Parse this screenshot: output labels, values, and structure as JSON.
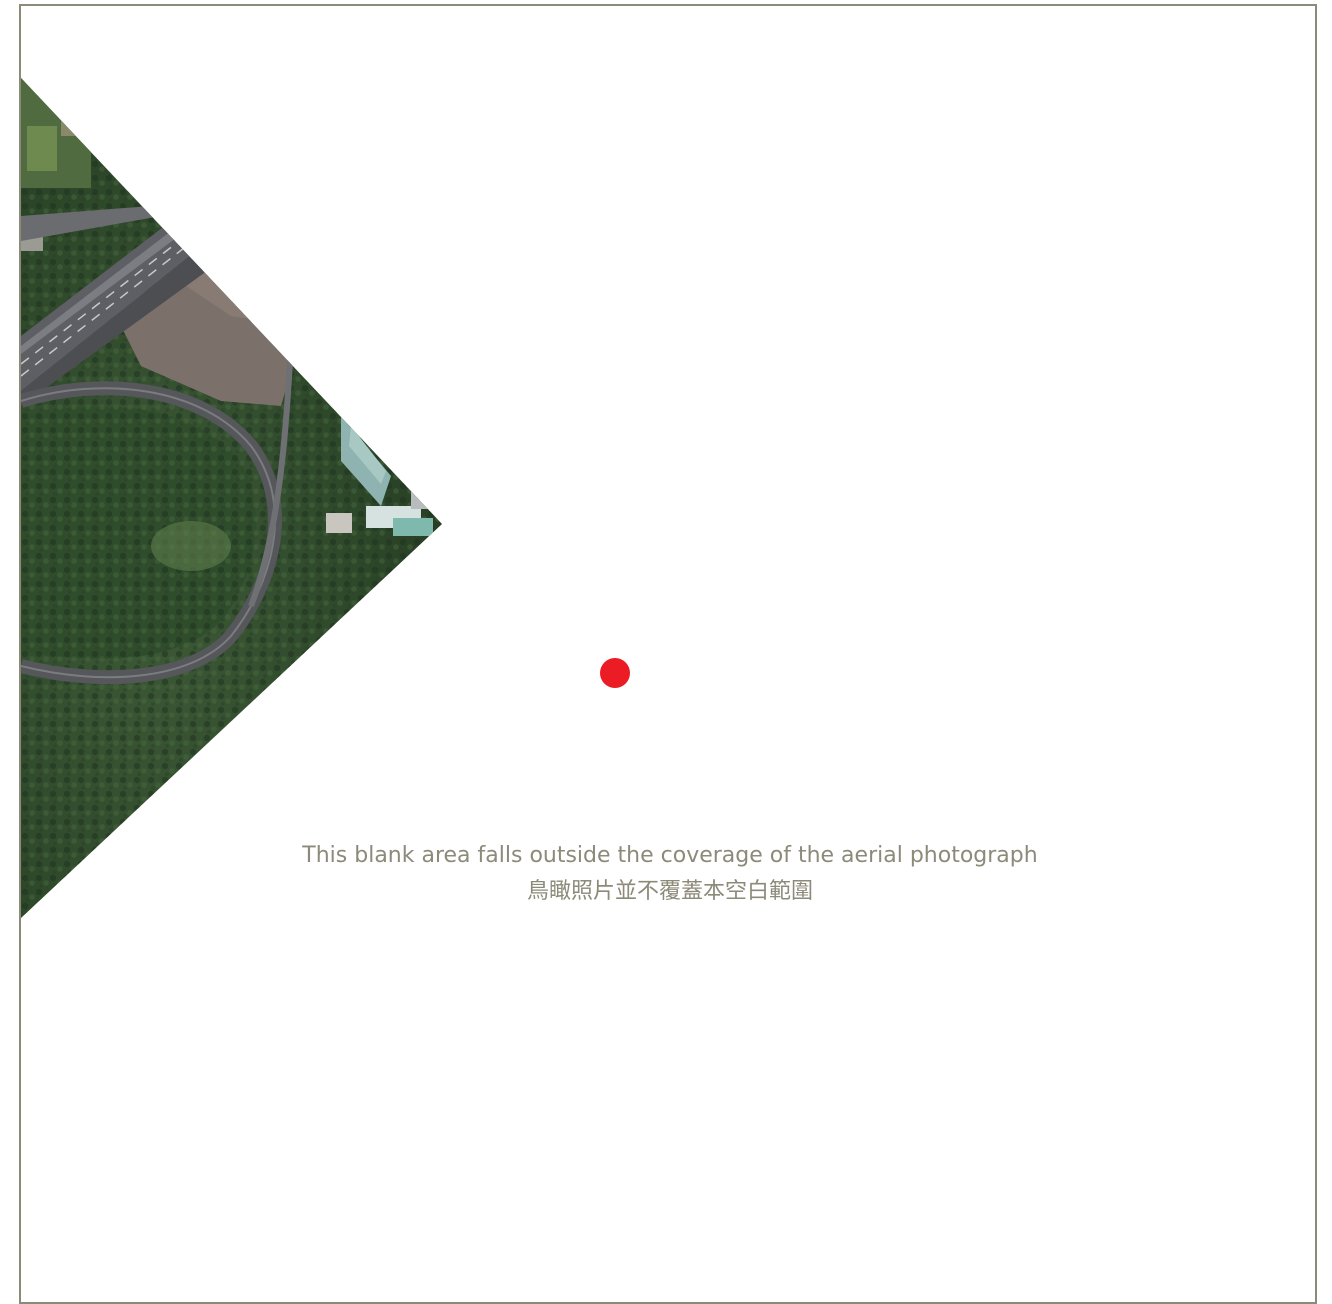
{
  "map": {
    "aerial_tile": {
      "type": "aerial-photograph",
      "features": [
        "expressway",
        "looping-ramp",
        "forest",
        "farmland",
        "greenhouses"
      ]
    },
    "marker": {
      "icon": "location-dot-icon",
      "color": "#ec1c24"
    },
    "coverage_note": {
      "english": "This blank area falls outside the coverage of the aerial photograph",
      "chinese": "鳥瞰照片並不覆蓋本空白範圍"
    },
    "colors": {
      "frame_border": "#8c8a78",
      "note_text": "#8c8a78",
      "marker": "#ec1c24"
    }
  }
}
